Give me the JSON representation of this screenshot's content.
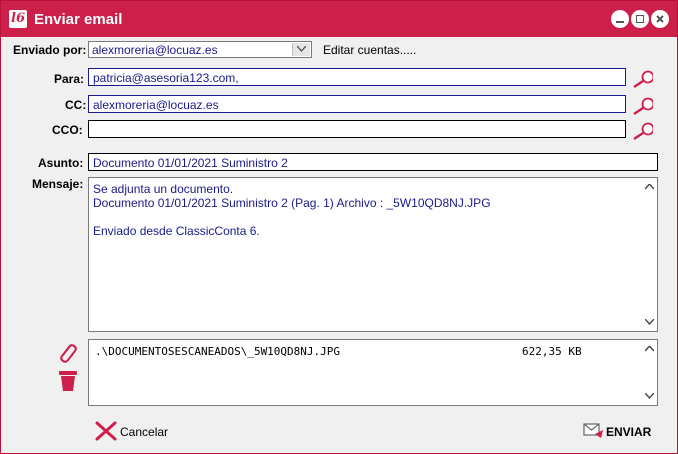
{
  "window": {
    "title": "Enviar email",
    "logo_text": "l6",
    "accent": "#cc1f4a",
    "text_color": "#1a1a8a"
  },
  "from": {
    "label": "Enviado por:",
    "value": "alexmoreria@locuaz.es",
    "edit_link": "Editar cuentas....."
  },
  "to": {
    "label": "Para:",
    "value": "patricia@asesoria123.com,"
  },
  "cc": {
    "label": "CC:",
    "value": "alexmoreria@locuaz.es"
  },
  "bcc": {
    "label": "CCO:",
    "value": ""
  },
  "subject": {
    "label": "Asunto:",
    "value": "Documento 01/01/2021 Suministro 2"
  },
  "message": {
    "label": "Mensaje:",
    "lines": [
      "Se adjunta un documento.",
      "Documento 01/01/2021 Suministro 2 (Pag. 1)  Archivo : _5W10QD8NJ.JPG",
      "",
      "Enviado desde ClassicConta 6."
    ]
  },
  "attachments": [
    {
      "path": ".\\DOCUMENTOSESCANEADOS\\_5W10QD8NJ.JPG",
      "size": "622,35 KB"
    }
  ],
  "buttons": {
    "cancel": "Cancelar",
    "send": "ENVIAR"
  },
  "icons": [
    "minimize-icon",
    "maximize-icon",
    "close-icon",
    "search-icon",
    "paperclip-icon",
    "trash-icon",
    "cancel-x-icon",
    "send-mail-icon"
  ]
}
